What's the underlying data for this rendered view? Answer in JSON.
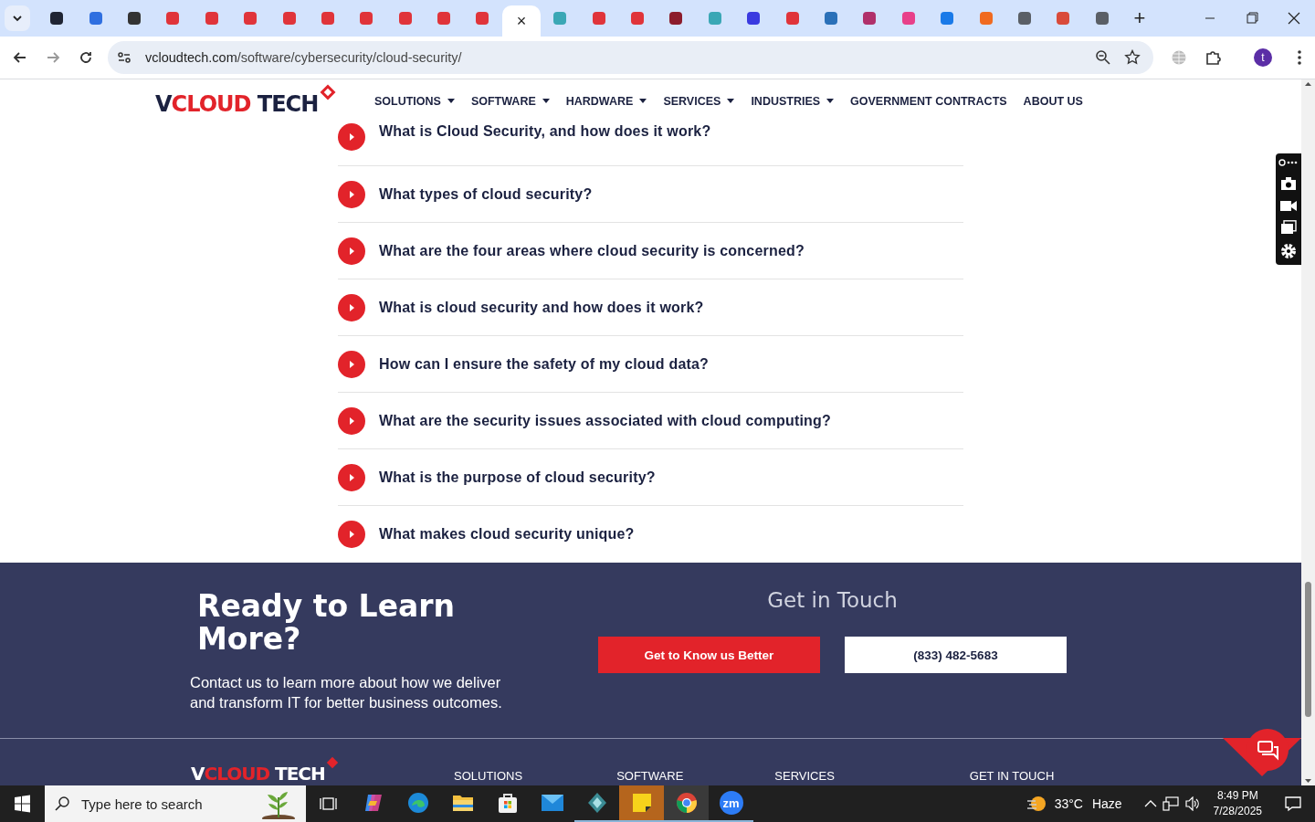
{
  "browser": {
    "tabs": [
      {
        "selected": false,
        "color": "#1f2433"
      },
      {
        "selected": false,
        "color": "#2f6fe0"
      },
      {
        "selected": false,
        "color": "#333333"
      },
      {
        "selected": false,
        "color": "#e0343a"
      },
      {
        "selected": false,
        "color": "#e0343a"
      },
      {
        "selected": false,
        "color": "#e0343a"
      },
      {
        "selected": false,
        "color": "#e0343a"
      },
      {
        "selected": false,
        "color": "#e0343a"
      },
      {
        "selected": false,
        "color": "#e0343a"
      },
      {
        "selected": false,
        "color": "#e0343a"
      },
      {
        "selected": false,
        "color": "#e0343a"
      },
      {
        "selected": false,
        "color": "#e0343a"
      },
      {
        "selected": true
      },
      {
        "selected": false,
        "color": "#3aa7b5"
      },
      {
        "selected": false,
        "color": "#e0343a"
      },
      {
        "selected": false,
        "color": "#e0343a"
      },
      {
        "selected": false,
        "color": "#8c1c2c"
      },
      {
        "selected": false,
        "color": "#3aa7b5"
      },
      {
        "selected": false,
        "color": "#3a3ae0"
      },
      {
        "selected": false,
        "color": "#e0343a"
      },
      {
        "selected": false,
        "color": "#2a70b8"
      },
      {
        "selected": false,
        "color": "#b0306a"
      },
      {
        "selected": false,
        "color": "#e8408a"
      },
      {
        "selected": false,
        "color": "#1a7ae8"
      },
      {
        "selected": false,
        "color": "#f06a20"
      },
      {
        "selected": false,
        "color": "#5a5f66"
      },
      {
        "selected": false,
        "color": "#d94a3a"
      },
      {
        "selected": false,
        "color": "#5a5f66"
      }
    ],
    "close_label": "×",
    "new_tab_label": "+",
    "url_host": "vcloudtech.com",
    "url_path": "/software/cybersecurity/cloud-security/",
    "profile_initial": "t"
  },
  "site_header": {
    "logo": {
      "v": "V",
      "cloud": "CLOUD",
      "tech": "TECH"
    },
    "nav": [
      {
        "label": "SOLUTIONS",
        "has_menu": true
      },
      {
        "label": "SOFTWARE",
        "has_menu": true
      },
      {
        "label": "HARDWARE",
        "has_menu": true
      },
      {
        "label": "SERVICES",
        "has_menu": true
      },
      {
        "label": "INDUSTRIES",
        "has_menu": true
      },
      {
        "label": "GOVERNMENT CONTRACTS",
        "has_menu": false
      },
      {
        "label": "ABOUT US",
        "has_menu": false
      }
    ]
  },
  "faq": [
    {
      "question": "What is Cloud Security, and how does it work?"
    },
    {
      "question": "What types of cloud security?"
    },
    {
      "question": "What are the four areas where cloud security is concerned?"
    },
    {
      "question": "What is cloud security and how does it work?"
    },
    {
      "question": "How can I ensure the safety of my cloud data?"
    },
    {
      "question": "What are the security issues associated with cloud computing?"
    },
    {
      "question": "What is the purpose of cloud security?"
    },
    {
      "question": "What makes cloud security unique?"
    }
  ],
  "cta": {
    "heading": "Ready to Learn More?",
    "text": "Contact us to learn more about how we deliver and transform IT for better business outcomes.",
    "contact_title": "Get in Touch",
    "buttons": [
      {
        "label": "Get to Know us Better",
        "kind": "primary"
      },
      {
        "label": "(833) 482-5683",
        "kind": "secondary"
      }
    ]
  },
  "footer": {
    "logo": {
      "v": "V",
      "cloud": "CLOUD",
      "tech": "TECH"
    },
    "columns": [
      "SOLUTIONS",
      "SOFTWARE",
      "SERVICES",
      "GET IN TOUCH"
    ]
  },
  "taskbar": {
    "search_placeholder": "Type here to search",
    "apps": [
      {
        "kind": "copilot",
        "running": false,
        "flashing": false,
        "selected": false
      },
      {
        "kind": "edge",
        "running": false,
        "flashing": false,
        "selected": false
      },
      {
        "kind": "files",
        "running": false,
        "flashing": false,
        "selected": false
      },
      {
        "kind": "store",
        "running": false,
        "flashing": false,
        "selected": false
      },
      {
        "kind": "mail",
        "running": false,
        "flashing": false,
        "selected": false
      },
      {
        "kind": "gem",
        "running": true,
        "flashing": false,
        "selected": false
      },
      {
        "kind": "sticky",
        "running": true,
        "flashing": true,
        "selected": false
      },
      {
        "kind": "chrome",
        "running": true,
        "flashing": false,
        "selected": true
      },
      {
        "kind": "zoom",
        "running": true,
        "flashing": false,
        "selected": false,
        "label": "zm"
      }
    ],
    "weather": {
      "temp": "33°C",
      "condition": "Haze"
    },
    "time": "8:49 PM",
    "date": "7/28/2025"
  }
}
